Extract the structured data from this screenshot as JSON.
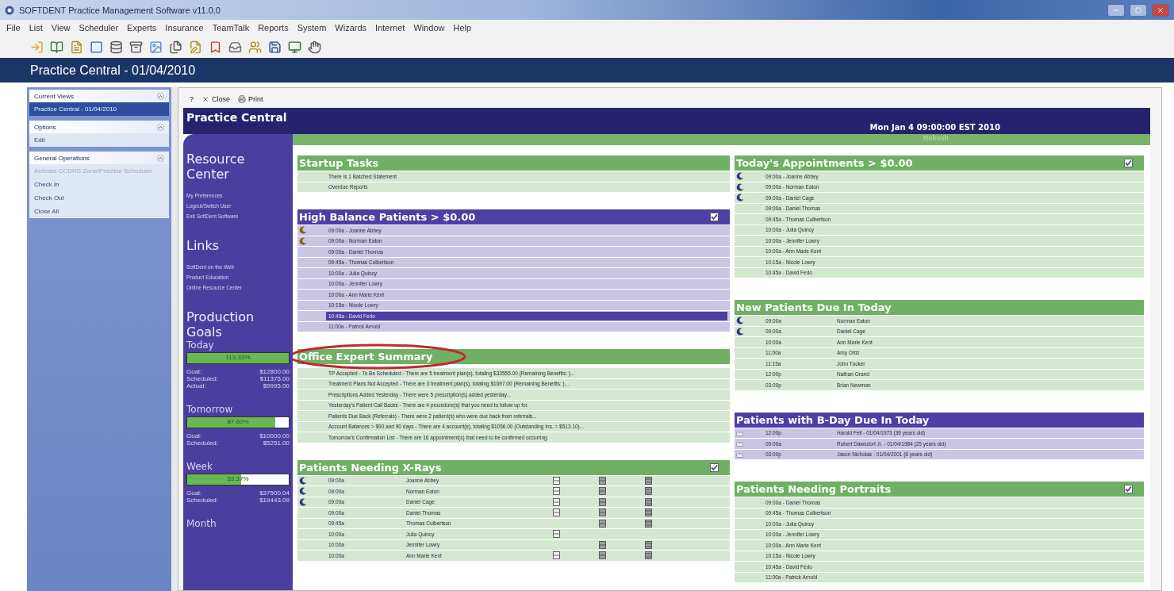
{
  "window": {
    "title": "SOFTDENT Practice Management Software v11.0.0"
  },
  "menu": [
    "File",
    "List",
    "View",
    "Scheduler",
    "Experts",
    "Insurance",
    "TeamTalk",
    "Reports",
    "System",
    "Wizards",
    "Internet",
    "Window",
    "Help"
  ],
  "banner": "Practice Central - 01/04/2010",
  "nav": [
    {
      "title": "Current Views",
      "items": [
        {
          "label": "Practice Central - 01/04/2010",
          "selected": true,
          "disabled": false
        }
      ]
    },
    {
      "title": "Options",
      "items": [
        {
          "label": "Edit",
          "selected": false,
          "disabled": false
        }
      ]
    },
    {
      "title": "General Operations",
      "items": [
        {
          "label": "Activate CCDHS Zone/Practice Scheduler",
          "selected": false,
          "disabled": true
        },
        {
          "label": "Check In",
          "selected": false,
          "disabled": false
        },
        {
          "label": "Check Out",
          "selected": false,
          "disabled": false
        },
        {
          "label": "Close All",
          "selected": false,
          "disabled": false
        }
      ]
    }
  ],
  "toolbar": {
    "help": "?",
    "close": "Close",
    "print": "Print"
  },
  "header": {
    "title": "Practice Central",
    "date": "Mon Jan 4 09:00:00 EST 2010",
    "refresh": "Refresh"
  },
  "sidebar": {
    "resource_title": "Resource Center",
    "resource_links": [
      "My Preferences",
      "Logout/Switch User",
      "Exit SoftDent Software"
    ],
    "links_title": "Links",
    "links": [
      "SoftDent on the Web",
      "Product Education",
      "Online Resource Center"
    ],
    "goals_title": "Production Goals",
    "goals": [
      {
        "label": "Today",
        "level": 1,
        "percent": "113.33%",
        "rows": [
          {
            "label": "Goal:",
            "value": "$12800.00"
          },
          {
            "label": "Scheduled:",
            "value": "$11375.00"
          },
          {
            "label": "Actual:",
            "value": "$9995.00"
          }
        ]
      },
      {
        "label": "Tomorrow",
        "level": 0.87,
        "percent": "87.60%",
        "rows": [
          {
            "label": "Goal:",
            "value": "$10000.00"
          },
          {
            "label": "Scheduled:",
            "value": "$5251.00"
          }
        ]
      },
      {
        "label": "Week",
        "level": 0.53,
        "percent": "53.37%",
        "rows": [
          {
            "label": "Goal:",
            "value": "$37500.04"
          },
          {
            "label": "Scheduled:",
            "value": "$19443.09"
          }
        ]
      },
      {
        "label": "Month"
      }
    ]
  },
  "columns": [
    [
      {
        "kind": "list",
        "color": "#6fb064",
        "title": "Startup Tasks",
        "rows": [
          {
            "flag": false,
            "text": "There is 1 Batched Statement"
          },
          {
            "flag": false,
            "text": "Overdue Reports"
          }
        ]
      },
      {
        "kind": "list",
        "color": "#4d3fa3",
        "title": "High Balance Patients > $0.00",
        "checked": true,
        "rows": [
          {
            "flag": true,
            "text": "09:00a - Joanne Abbey",
            "selected": false
          },
          {
            "flag": true,
            "text": "09:00a - Norman Eaton",
            "selected": false
          },
          {
            "flag": false,
            "text": "09:00a - Daniel Thomas",
            "selected": false
          },
          {
            "flag": false,
            "text": "09:45a - Thomas Culbertson",
            "selected": false
          },
          {
            "flag": false,
            "text": "10:00a - Julia Quincy",
            "selected": false
          },
          {
            "flag": false,
            "text": "10:00a - Jennifer Lowry",
            "selected": false
          },
          {
            "flag": false,
            "text": "10:00a - Ann Marie Kent",
            "selected": false
          },
          {
            "flag": false,
            "text": "10:15a - Nicole Lowry",
            "selected": false
          },
          {
            "flag": false,
            "text": "10:45a - David Fedo",
            "selected": true
          },
          {
            "flag": false,
            "text": "11:00a - Patrick Arnold",
            "selected": false
          }
        ]
      },
      {
        "kind": "list",
        "color": "#6fb064",
        "title": "Office Expert Summary",
        "highlighted": true,
        "rows": [
          {
            "flag": false,
            "text": "TP Accepted - To Be Scheduled - There are 5 treatment plan(s), totaling $33555.00 (Remaining Benefits: )..."
          },
          {
            "flag": false,
            "text": "Treatment Plans Not Accepted - There are 3 treatment plan(s), totaling $1697.00 (Remaining Benefits: )..."
          },
          {
            "flag": false,
            "text": "Prescriptions Added Yesterday - There were 5 prescription(s) added yesterday..."
          },
          {
            "flag": false,
            "text": "Yesterday's Patient Call Backs - There are 4 procedure(s) that you need to follow up for."
          },
          {
            "flag": false,
            "text": "Patients Due Back (Referrals) - There were 2 patient(s) who were due back from referrals..."
          },
          {
            "flag": false,
            "text": "Account Balances > $90 and 90 days - There are 4 account(s), totaling $1056.00 (Outstanding Ins. = $513.10)..."
          },
          {
            "flag": false,
            "text": "Tomorrow's Confirmation List - There are 16 appointment(s) that need to be confirmed occurring."
          }
        ]
      },
      {
        "kind": "xray",
        "color": "#6fb064",
        "title": "Patients Needing X-Rays",
        "checked": true,
        "rows": [
          {
            "flag": true,
            "time": "09:00a",
            "name": "Joanne Abbey",
            "xrays": [
              true,
              true,
              true
            ]
          },
          {
            "flag": true,
            "time": "09:00a",
            "name": "Norman Eaton",
            "xrays": [
              true,
              true,
              true
            ]
          },
          {
            "flag": true,
            "time": "09:00a",
            "name": "Daniel Cage",
            "xrays": [
              true,
              true,
              true
            ]
          },
          {
            "flag": false,
            "time": "09:00a",
            "name": "Daniel Thomas",
            "xrays": [
              true,
              true,
              true
            ]
          },
          {
            "flag": false,
            "time": "09:45a",
            "name": "Thomas Culbertson",
            "xrays": [
              false,
              true,
              true
            ]
          },
          {
            "flag": false,
            "time": "10:00a",
            "name": "Julia Quincy",
            "xrays": [
              true,
              false,
              false
            ]
          },
          {
            "flag": false,
            "time": "10:00a",
            "name": "Jennifer Lowry",
            "xrays": [
              false,
              true,
              true
            ]
          },
          {
            "flag": false,
            "time": "10:00a",
            "name": "Ann Marie Kent",
            "xrays": [
              true,
              true,
              true
            ]
          }
        ]
      }
    ],
    [
      {
        "kind": "list",
        "color": "#6fb064",
        "title": "Today's Appointments > $0.00",
        "checked": true,
        "rows": [
          {
            "flag": true,
            "text": "09:00a - Joanne Abbey"
          },
          {
            "flag": true,
            "text": "09:00a - Norman Eaton"
          },
          {
            "flag": true,
            "text": "09:00a - Daniel Cage"
          },
          {
            "flag": false,
            "text": "09:00a - Daniel Thomas"
          },
          {
            "flag": false,
            "text": "09:45a - Thomas Culbertson"
          },
          {
            "flag": false,
            "text": "10:00a - Julia Quincy"
          },
          {
            "flag": false,
            "text": "10:00a - Jennifer Lowry"
          },
          {
            "flag": false,
            "text": "10:00a - Ann Marie Kent"
          },
          {
            "flag": false,
            "text": "10:15a - Nicole Lowry"
          },
          {
            "flag": false,
            "text": "10:45a - David Fedo"
          }
        ]
      },
      {
        "kind": "split",
        "color": "#6fb064",
        "title": "New Patients Due In Today",
        "rows": [
          {
            "flag": true,
            "time": "09:00a",
            "name": "Norman Eaton"
          },
          {
            "flag": true,
            "time": "09:00a",
            "name": "Daniel Cage"
          },
          {
            "flag": false,
            "time": "10:00a",
            "name": "Ann Marie Kent"
          },
          {
            "flag": false,
            "time": "11:00a",
            "name": "Amy Ortiz"
          },
          {
            "flag": false,
            "time": "11:15a",
            "name": "John Tucker"
          },
          {
            "flag": false,
            "time": "12:00p",
            "name": "Nathan Grand"
          },
          {
            "flag": false,
            "time": "03:00p",
            "name": "Brian Newman"
          }
        ]
      },
      {
        "kind": "bday",
        "color": "#4d3fa3",
        "title": "Patients with B-Day Due In Today",
        "rows": [
          {
            "time": "12:00p",
            "name": "Harold Fell - 01/04/1973 (36 years old)"
          },
          {
            "time": "09:00a",
            "name": "Robert Dawsdorf Jr. - 01/04/1984 (25 years old)"
          },
          {
            "time": "03:00p",
            "name": "Jason Nicholas - 01/04/2001 (8 years old)"
          }
        ]
      },
      {
        "kind": "list",
        "color": "#6fb064",
        "title": "Patients Needing Portraits",
        "checked": true,
        "rows": [
          {
            "flag": false,
            "text": "09:00a - Daniel Thomas"
          },
          {
            "flag": false,
            "text": "09:45a - Thomas Culbertson"
          },
          {
            "flag": false,
            "text": "10:00a - Julia Quincy"
          },
          {
            "flag": false,
            "text": "10:00a - Jennifer Lowry"
          },
          {
            "flag": false,
            "text": "10:00a - Ann Marie Kent"
          },
          {
            "flag": false,
            "text": "10:15a - Nicole Lowry"
          },
          {
            "flag": false,
            "text": "10:45a - David Fedo"
          },
          {
            "flag": false,
            "text": "11:00a - Patrick Arnold"
          }
        ]
      }
    ]
  ]
}
